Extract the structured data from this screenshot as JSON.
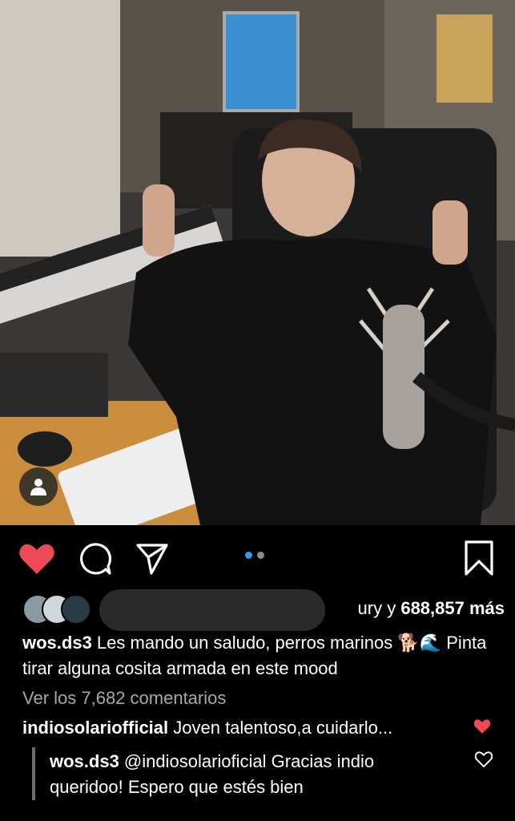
{
  "post": {
    "likes": {
      "prefix": "ury y ",
      "count": "688,857 más"
    },
    "caption": {
      "user": "wos.ds3",
      "text": " Les mando un saludo, perros marinos 🐕🌊 Pinta tirar alguna cosita armada en este mood"
    },
    "view_comments": "Ver los 7,682 comentarios",
    "comment": {
      "user": "indiosolariofficial",
      "text": " Joven  talentoso,a cuidarlo..."
    },
    "reply": {
      "user": "wos.ds3",
      "text": " @indiosolarioficial Gracias indio queridoo! Espero que estés bien"
    }
  },
  "carousel": {
    "current": 1,
    "total": 2
  },
  "icons": {
    "like": "heart-filled-icon",
    "comment": "comment-bubble-icon",
    "share": "paper-plane-icon",
    "save": "bookmark-icon",
    "tag": "user-tag-icon"
  },
  "colors": {
    "like_red": "#ed4956",
    "carousel_active": "#3897f0",
    "muted_text": "#a8a8a8"
  }
}
